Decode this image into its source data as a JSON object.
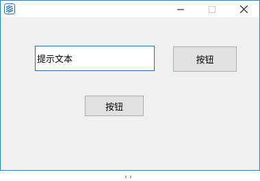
{
  "window": {
    "icon": "app-icon",
    "controls": {
      "minimize": "minimize-icon",
      "maximize": "maximize-icon",
      "close": "close-icon"
    }
  },
  "form": {
    "textbox_value": "提示文本",
    "button_right_label": "按钮",
    "button_bottom_label": "按钮"
  },
  "colors": {
    "accent": "#1883d7",
    "window_bg": "#f0f0f0",
    "button_bg": "#e1e1e1",
    "button_border": "#adadad"
  }
}
